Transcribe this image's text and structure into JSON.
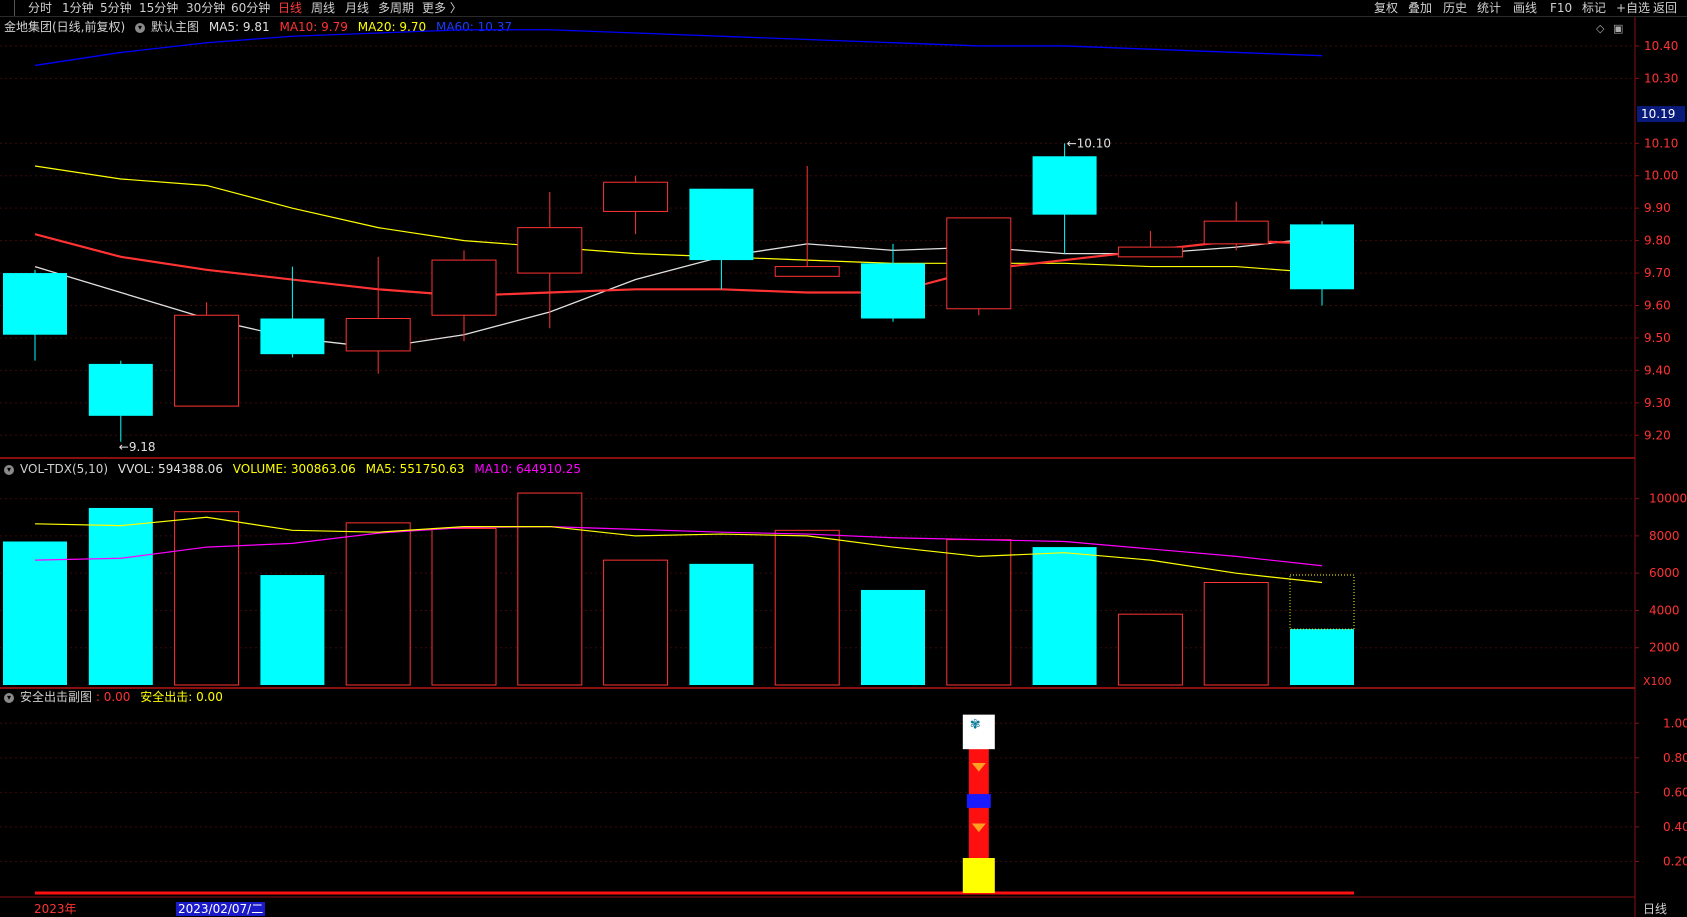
{
  "toolbar": {
    "left": [
      "分时",
      "1分钟",
      "5分钟",
      "15分钟",
      "30分钟",
      "60分钟",
      "日线",
      "周线",
      "月线",
      "多周期",
      "更多 〉"
    ],
    "active": "日线",
    "right": [
      "复权",
      "叠加",
      "历史",
      "统计",
      "画线",
      "F10",
      "标记",
      "+自选",
      "返回"
    ]
  },
  "main_legend": {
    "title": "金地集团(日线,前复权)",
    "chart": "默认主图",
    "ma5": "MA5: 9.81",
    "ma10": "MA10: 9.79",
    "ma20": "MA20: 9.70",
    "ma60": "MA60: 10.37"
  },
  "vol_legend": {
    "title": "VOL-TDX(5,10)",
    "vvol": "VVOL: 594388.06",
    "volume": "VOLUME: 300863.06",
    "ma5": "MA5: 551750.63",
    "ma10": "MA10: 644910.25"
  },
  "sub_legend": {
    "title": "安全出击副图",
    "v1": ": 0.00",
    "v2": "安全出击: 0.00"
  },
  "price_axis": [
    "10.40",
    "10.30",
    "10.10",
    "10.00",
    "9.90",
    "9.80",
    "9.70",
    "9.60",
    "9.50",
    "9.40",
    "9.30",
    "9.20"
  ],
  "current_price": "10.19",
  "max_label": "10.10",
  "min_label": "9.18",
  "vol_axis": [
    "10000",
    "8000",
    "6000",
    "4000",
    "2000"
  ],
  "vol_unit": "X100",
  "sub_axis": [
    "1.00",
    "0.80",
    "0.60",
    "0.40",
    "0.20"
  ],
  "date_year": "2023年",
  "date_cursor": "2023/02/07/二",
  "period_label": "日线",
  "colors": {
    "up": "#ff3333",
    "down": "#00ffff",
    "ma5": "#e0e0e0",
    "ma10": "#ffff00",
    "ma20": "#ff00ff",
    "ma60": "#0000ff"
  },
  "chart_data": {
    "type": "candlestick",
    "candles": [
      {
        "o": 9.7,
        "c": 9.51,
        "h": 9.71,
        "l": 9.43
      },
      {
        "o": 9.42,
        "c": 9.26,
        "h": 9.43,
        "l": 9.18
      },
      {
        "o": 9.29,
        "c": 9.57,
        "h": 9.61,
        "l": 9.29
      },
      {
        "o": 9.56,
        "c": 9.45,
        "h": 9.72,
        "l": 9.44
      },
      {
        "o": 9.46,
        "c": 9.56,
        "h": 9.75,
        "l": 9.39
      },
      {
        "o": 9.57,
        "c": 9.74,
        "h": 9.77,
        "l": 9.49
      },
      {
        "o": 9.7,
        "c": 9.84,
        "h": 9.95,
        "l": 9.53
      },
      {
        "o": 9.89,
        "c": 9.98,
        "h": 10.0,
        "l": 9.82
      },
      {
        "o": 9.96,
        "c": 9.74,
        "h": 9.96,
        "l": 9.65
      },
      {
        "o": 9.69,
        "c": 9.72,
        "h": 10.03,
        "l": 9.69
      },
      {
        "o": 9.73,
        "c": 9.56,
        "h": 9.79,
        "l": 9.55
      },
      {
        "o": 9.59,
        "c": 9.87,
        "h": 9.87,
        "l": 9.57
      },
      {
        "o": 10.06,
        "c": 9.88,
        "h": 10.1,
        "l": 9.76
      },
      {
        "o": 9.75,
        "c": 9.78,
        "h": 9.83,
        "l": 9.75
      },
      {
        "o": 9.79,
        "c": 9.86,
        "h": 9.92,
        "l": 9.77
      },
      {
        "o": 9.85,
        "c": 9.65,
        "h": 9.86,
        "l": 9.6
      }
    ],
    "ma5": [
      9.72,
      9.64,
      9.56,
      9.5,
      9.47,
      9.51,
      9.58,
      9.68,
      9.75,
      9.79,
      9.77,
      9.78,
      9.76,
      9.76,
      9.78,
      9.81
    ],
    "ma10": [
      10.03,
      9.99,
      9.97,
      9.9,
      9.84,
      9.8,
      9.78,
      9.76,
      9.75,
      9.74,
      9.73,
      9.73,
      9.73,
      9.72,
      9.72,
      9.7
    ],
    "ma20": [
      9.82,
      9.75,
      9.71,
      9.68,
      9.65,
      9.63,
      9.64,
      9.65,
      9.65,
      9.64,
      9.64,
      9.71,
      9.74,
      9.77,
      9.8,
      9.79
    ],
    "ma60": [
      10.34,
      10.38,
      10.41,
      10.43,
      10.44,
      10.45,
      10.45,
      10.44,
      10.43,
      10.42,
      10.41,
      10.4,
      10.4,
      10.39,
      10.38,
      10.37
    ],
    "volume": [
      7700,
      9500,
      9300,
      5900,
      8700,
      8400,
      10300,
      6700,
      6500,
      8300,
      5100,
      7800,
      7400,
      3800,
      5500,
      3000
    ],
    "vol_ma5": [
      8650,
      8550,
      9000,
      8300,
      8200,
      8500,
      8500,
      8000,
      8100,
      8000,
      7400,
      6900,
      7100,
      6700,
      6000,
      5500
    ],
    "vol_ma10": [
      6700,
      6800,
      7400,
      7600,
      8150,
      8450,
      8500,
      8350,
      8200,
      8100,
      7900,
      7800,
      7700,
      7300,
      6900,
      6400
    ],
    "signal_index": 11,
    "price_range": [
      9.13,
      10.48
    ],
    "vol_range": [
      0,
      11000
    ],
    "sub_range": [
      0,
      1.1
    ]
  }
}
